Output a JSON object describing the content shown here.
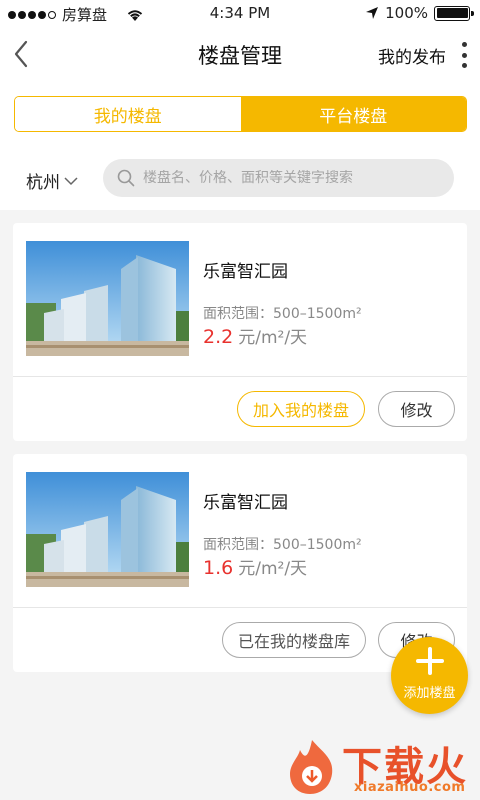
{
  "status_bar": {
    "carrier": "房算盘",
    "time": "4:34 PM",
    "battery": "100%",
    "battery_level": 1.0,
    "signal_bars": 4
  },
  "nav": {
    "title": "楼盘管理",
    "right_label": "我的发布"
  },
  "tabs": [
    {
      "label": "我的楼盘",
      "active": false
    },
    {
      "label": "平台楼盘",
      "active": true
    }
  ],
  "filter": {
    "city": "杭州",
    "search_placeholder": "楼盘名、价格、面积等关键字搜索"
  },
  "listings": [
    {
      "name": "乐富智汇园",
      "area": "面积范围：500–1500m²",
      "price_value": "2.2",
      "price_unit": "元/m²/天",
      "action_label": "加入我的楼盘",
      "action_state": "add",
      "edit_label": "修改"
    },
    {
      "name": "乐富智汇园",
      "area": "面积范围：500–1500m²",
      "price_value": "1.6",
      "price_unit": "元/m²/天",
      "action_label": "已在我的楼盘库",
      "action_state": "added",
      "edit_label": "修改"
    }
  ],
  "fab": {
    "label": "添加楼盘"
  },
  "watermark": {
    "text": "下载火",
    "url": "xiazaihuo.com"
  },
  "colors": {
    "accent": "#f5b800",
    "price": "#e8322e",
    "background": "#f4f4f4"
  }
}
